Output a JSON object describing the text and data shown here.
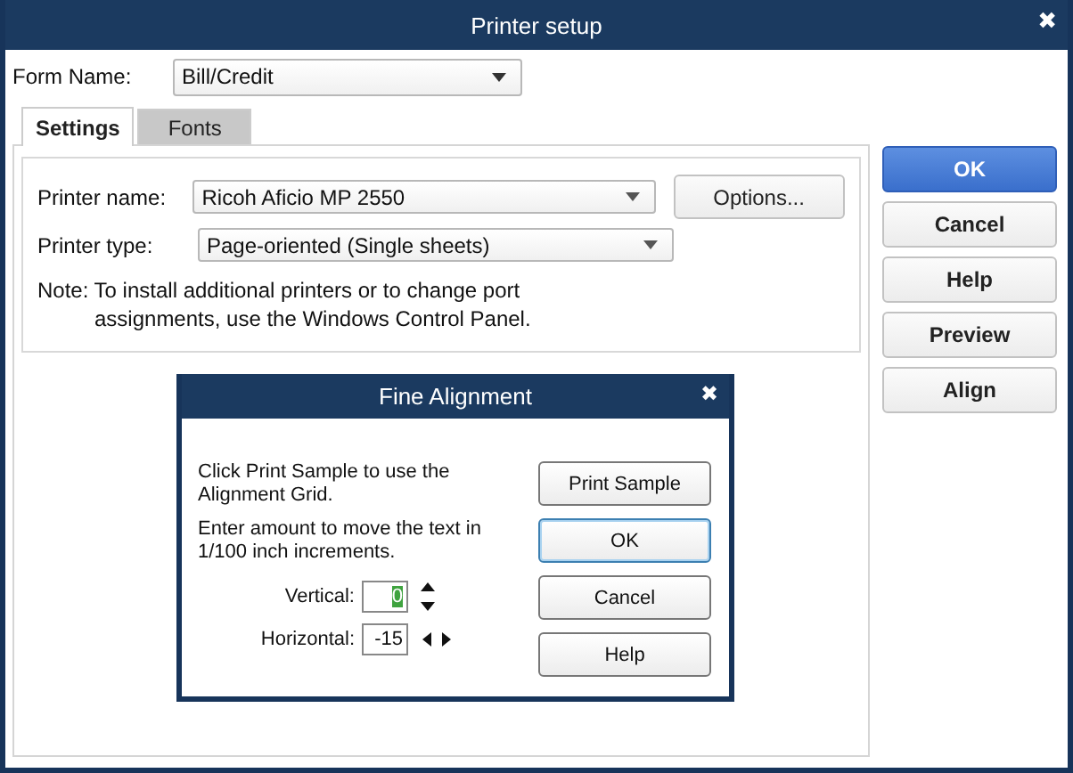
{
  "window": {
    "title": "Printer setup",
    "close": "✖"
  },
  "form_name": {
    "label": "Form Name:",
    "value": "Bill/Credit"
  },
  "tabs": [
    {
      "label": "Settings",
      "selected": true
    },
    {
      "label": "Fonts",
      "selected": false
    }
  ],
  "settings": {
    "printer_name": {
      "label": "Printer name:",
      "value": "Ricoh Aficio MP 2550"
    },
    "printer_type": {
      "label": "Printer type:",
      "value": "Page-oriented (Single sheets)"
    },
    "options_button": "Options...",
    "note_lines": [
      "Note: To install additional printers or to change port",
      "assignments, use the Windows Control Panel."
    ]
  },
  "buttons": [
    {
      "label": "OK",
      "default": true
    },
    {
      "label": "Cancel",
      "default": false
    },
    {
      "label": "Help",
      "default": false
    },
    {
      "label": "Preview",
      "default": false
    },
    {
      "label": "Align",
      "default": false
    }
  ],
  "dialog": {
    "title": "Fine Alignment",
    "close": "✖",
    "text_1": "Click Print Sample to use the Alignment Grid.",
    "text_2": "Enter amount to move the text in 1/100 inch increments.",
    "vertical": {
      "label": "Vertical:",
      "value": "0",
      "text_selected": true
    },
    "horizontal": {
      "label": "Horizontal:",
      "value": "-15",
      "text_selected": false
    },
    "buttons": [
      {
        "label": "Print Sample",
        "focused": false
      },
      {
        "label": "OK",
        "focused": true
      },
      {
        "label": "Cancel",
        "focused": false
      },
      {
        "label": "Help",
        "focused": false
      }
    ]
  }
}
